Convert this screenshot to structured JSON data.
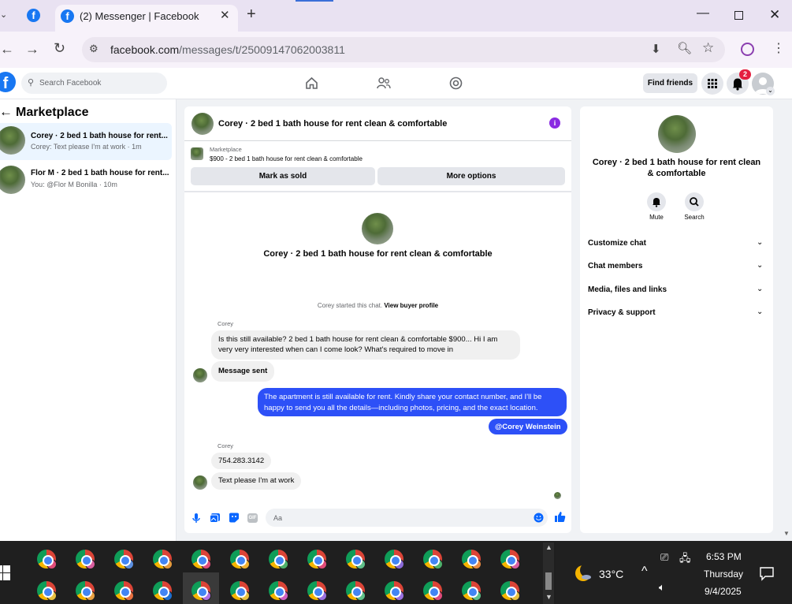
{
  "browser": {
    "tab_title": "(2) Messenger | Facebook",
    "url_domain": "facebook.com",
    "url_path": "/messages/t/25009147062003811"
  },
  "fb": {
    "search_placeholder": "Search Facebook",
    "find_friends": "Find friends",
    "notification_count": "2"
  },
  "sidebar": {
    "title": "Marketplace",
    "conversations": [
      {
        "title": "Corey · 2 bed 1 bath house for rent...",
        "subtitle": "Corey: Text please I'm at work · 1m"
      },
      {
        "title": "Flor M · 2 bed 1 bath house for rent...",
        "subtitle": "You: @Flor M Bonilla · 10m"
      }
    ]
  },
  "chat": {
    "header_title": "Corey · 2 bed 1 bath house for rent clean & comfortable",
    "listing_label": "Marketplace",
    "listing_text": "$900 - 2 bed 1 bath house for rent clean & comfortable",
    "mark_sold": "Mark as sold",
    "more_options": "More options",
    "profile_name": "Corey · 2 bed 1 bath house for rent clean & comfortable",
    "started_text": "Corey started this chat.",
    "view_profile": "View buyer profile",
    "messages": [
      {
        "sender": "Corey",
        "text": "Is this still available? 2 bed 1 bath house for rent clean & comfortable $900... Hi I am very very interested when can I come look? What's required to move in"
      },
      {
        "text": "Message sent"
      },
      {
        "text": "The apartment is still available for rent. Kindly share your contact number, and I'll be happy to send you all the details—including photos, pricing, and the exact location."
      },
      {
        "text": "@Corey Weinstein"
      },
      {
        "sender": "Corey",
        "text": "754.283.3142"
      },
      {
        "text": "Text please I'm at work"
      }
    ],
    "input_placeholder": "Aa"
  },
  "details": {
    "name": "Corey · 2 bed 1 bath house for rent clean & comfortable",
    "mute": "Mute",
    "search": "Search",
    "sections": [
      "Customize chat",
      "Chat members",
      "Media, files and links",
      "Privacy & support"
    ]
  },
  "taskbar": {
    "temperature": "33°C",
    "time": "6:53 PM",
    "day": "Thursday",
    "date": "9/4/2025"
  },
  "colors": {
    "fb_blue": "#1877f2",
    "outgoing_bubble": "#2d50f7",
    "purple_info": "#8a2be2"
  }
}
